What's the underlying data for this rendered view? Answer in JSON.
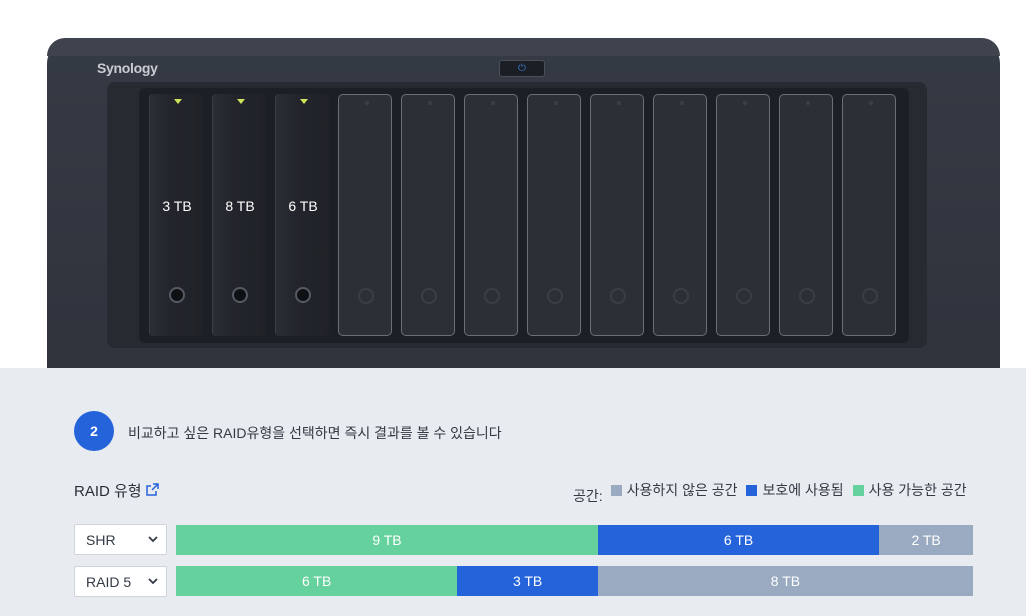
{
  "device": {
    "brand": "Synology",
    "bays": [
      {
        "size": "3 TB",
        "filled": true
      },
      {
        "size": "8 TB",
        "filled": true
      },
      {
        "size": "6 TB",
        "filled": true
      },
      {
        "size": "",
        "filled": false
      },
      {
        "size": "",
        "filled": false
      },
      {
        "size": "",
        "filled": false
      },
      {
        "size": "",
        "filled": false
      },
      {
        "size": "",
        "filled": false
      },
      {
        "size": "",
        "filled": false
      },
      {
        "size": "",
        "filled": false
      },
      {
        "size": "",
        "filled": false
      },
      {
        "size": "",
        "filled": false
      }
    ]
  },
  "step": {
    "number": "2",
    "text": "비교하고 싶은 RAID유형을 선택하면 즉시 결과를 볼 수 있습니다"
  },
  "raid": {
    "title": "RAID 유형"
  },
  "legend": {
    "label": "공간:",
    "items": [
      {
        "label": "사용하지 않은 공간",
        "color": "#9aaac1"
      },
      {
        "label": "보호에 사용됨",
        "color": "#2563db"
      },
      {
        "label": "사용 가능한 공간",
        "color": "#65d19d"
      }
    ]
  },
  "rows": [
    {
      "select": "SHR",
      "segments": [
        {
          "label": "9 TB",
          "tb": 9,
          "kind": "available"
        },
        {
          "label": "6 TB",
          "tb": 6,
          "kind": "protection"
        },
        {
          "label": "2 TB",
          "tb": 2,
          "kind": "unused"
        }
      ]
    },
    {
      "select": "RAID 5",
      "segments": [
        {
          "label": "6 TB",
          "tb": 6,
          "kind": "available"
        },
        {
          "label": "3 TB",
          "tb": 3,
          "kind": "protection"
        },
        {
          "label": "8 TB",
          "tb": 8,
          "kind": "unused"
        }
      ]
    }
  ],
  "colors": {
    "available": "#65d19d",
    "protection": "#2563db",
    "unused": "#9aaac1"
  }
}
